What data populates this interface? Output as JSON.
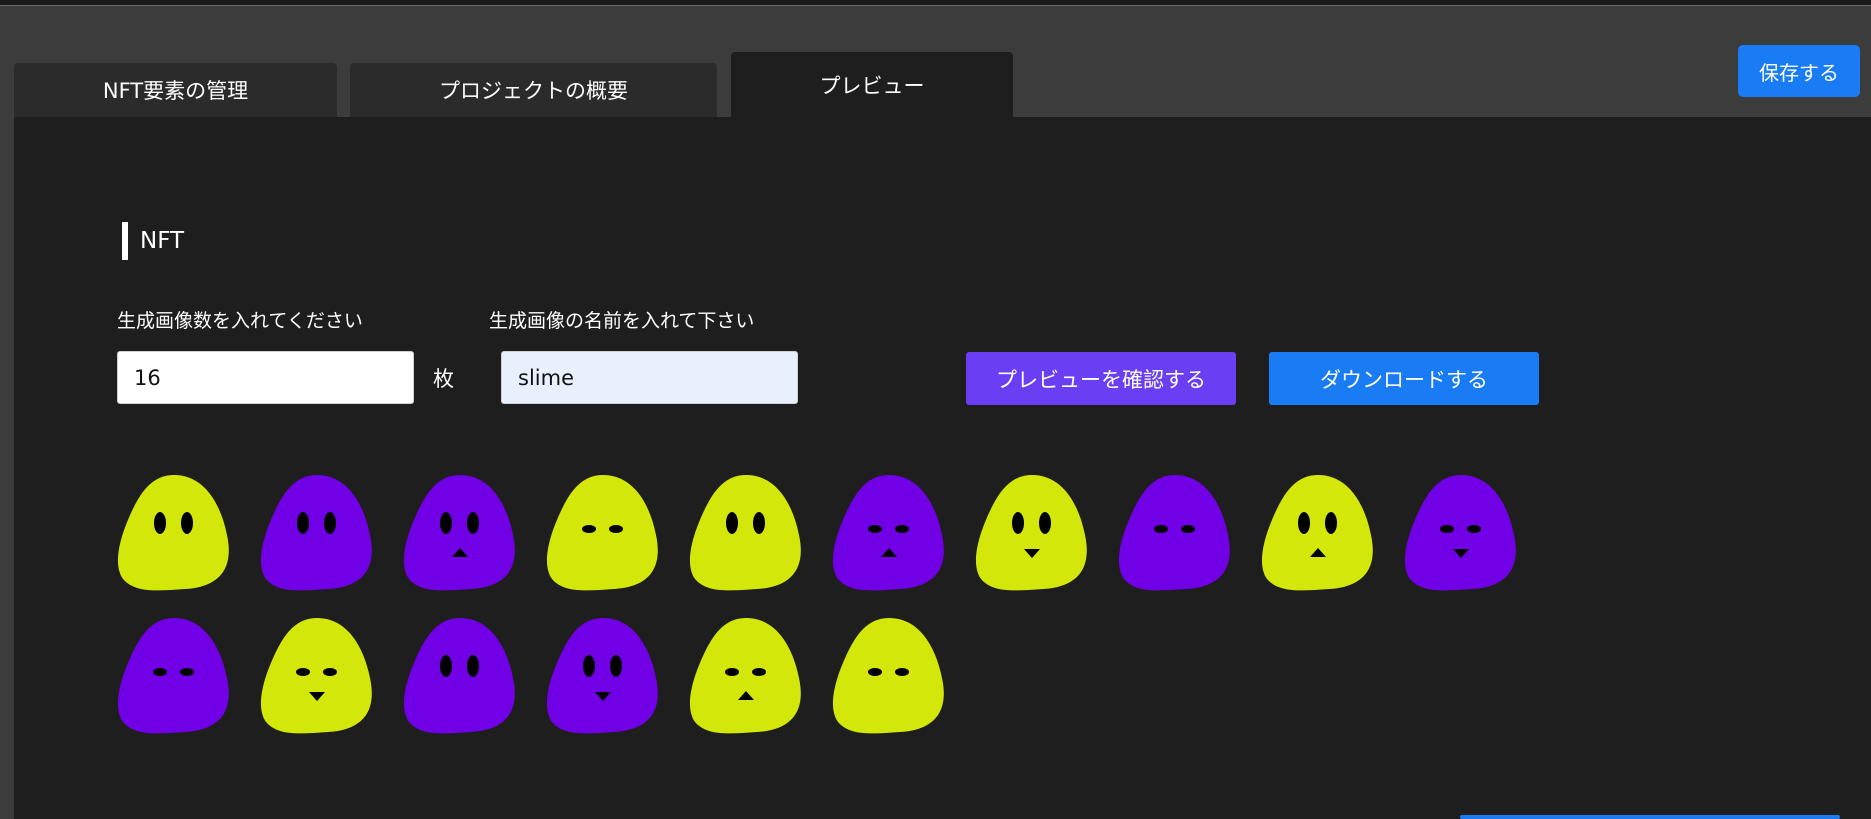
{
  "tabs": {
    "nft_elements": "NFT要素の管理",
    "overview": "プロジェクトの概要",
    "preview": "プレビュー"
  },
  "header": {
    "save_label": "保存する"
  },
  "section": {
    "title": "NFT"
  },
  "form": {
    "count_label": "生成画像数を入れてください",
    "count_value": "16",
    "count_unit": "枚",
    "name_label": "生成画像の名前を入れて下さい",
    "name_value": "slime"
  },
  "actions": {
    "preview_label": "プレビューを確認する",
    "download_label": "ダウンロードする"
  },
  "colors": {
    "yellow": "#d3e80a",
    "purple": "#7200e6",
    "save": "#1a7cf4",
    "preview": "#6a3ef2"
  },
  "nfts": [
    {
      "color": "yellow",
      "eyes": "round",
      "mouth": "none"
    },
    {
      "color": "purple",
      "eyes": "round",
      "mouth": "none"
    },
    {
      "color": "purple",
      "eyes": "round",
      "mouth": "up"
    },
    {
      "color": "yellow",
      "eyes": "narrow",
      "mouth": "none"
    },
    {
      "color": "yellow",
      "eyes": "round",
      "mouth": "none"
    },
    {
      "color": "purple",
      "eyes": "narrow",
      "mouth": "up"
    },
    {
      "color": "yellow",
      "eyes": "round",
      "mouth": "down"
    },
    {
      "color": "purple",
      "eyes": "narrow",
      "mouth": "none"
    },
    {
      "color": "yellow",
      "eyes": "round",
      "mouth": "up"
    },
    {
      "color": "purple",
      "eyes": "narrow",
      "mouth": "down"
    },
    {
      "color": "purple",
      "eyes": "narrow",
      "mouth": "none"
    },
    {
      "color": "yellow",
      "eyes": "narrow",
      "mouth": "down"
    },
    {
      "color": "purple",
      "eyes": "round",
      "mouth": "none"
    },
    {
      "color": "purple",
      "eyes": "round",
      "mouth": "down"
    },
    {
      "color": "yellow",
      "eyes": "narrow",
      "mouth": "up"
    },
    {
      "color": "yellow",
      "eyes": "narrow",
      "mouth": "none"
    }
  ]
}
